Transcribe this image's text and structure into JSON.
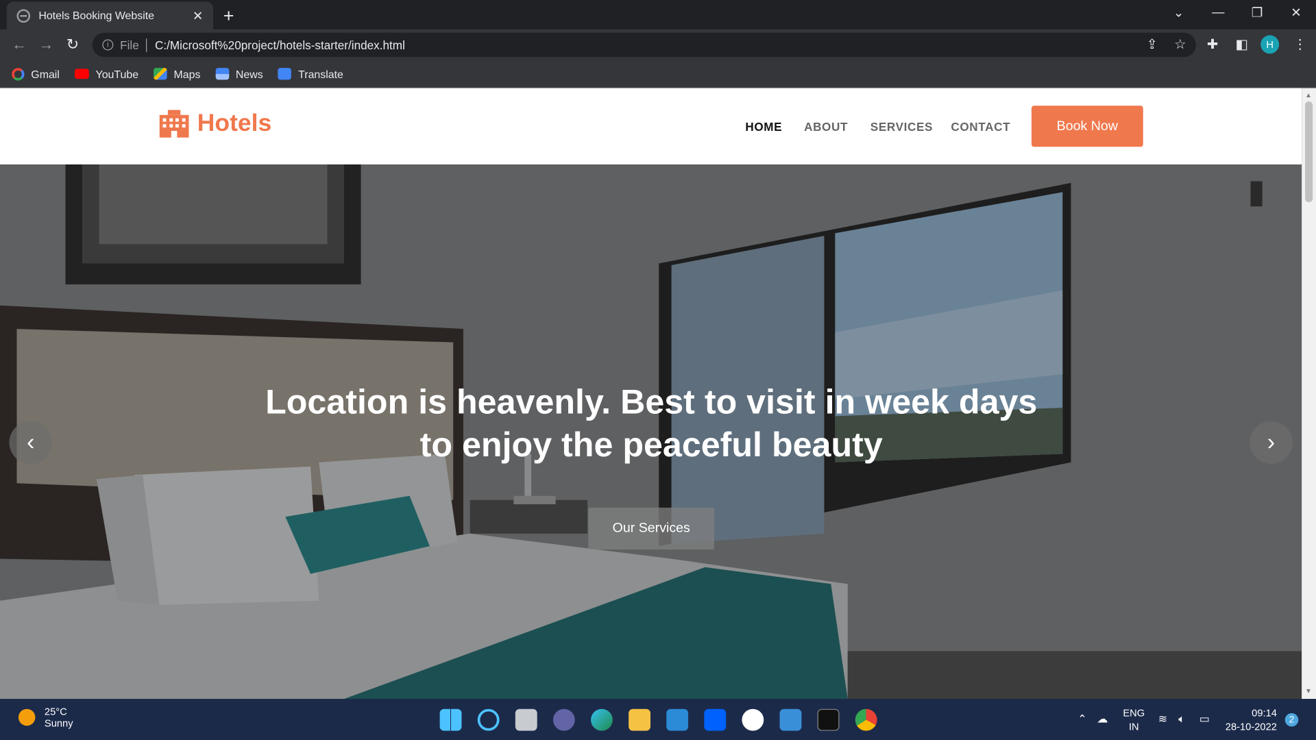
{
  "browser": {
    "tab_title": "Hotels Booking Website",
    "address_prefix": "File",
    "url": "C:/Microsoft%20project/hotels-starter/index.html",
    "profile_initial": "H",
    "bookmarks": [
      {
        "label": "Gmail",
        "color": "#ea4335"
      },
      {
        "label": "YouTube",
        "color": "#ff0000"
      },
      {
        "label": "Maps",
        "color": "#34a853"
      },
      {
        "label": "News",
        "color": "#4285f4"
      },
      {
        "label": "Translate",
        "color": "#4285f4"
      }
    ]
  },
  "site": {
    "brand": "Hotels",
    "brand_color": "#f0784d",
    "nav": [
      {
        "label": "HOME",
        "active": true
      },
      {
        "label": "ABOUT",
        "active": false
      },
      {
        "label": "SERVICES",
        "active": false
      },
      {
        "label": "CONTACT",
        "active": false
      }
    ],
    "cta": "Book Now",
    "hero": {
      "title_line1": "Location is heavenly. Best to visit in week days",
      "title_line2": "to enjoy the peaceful beauty",
      "button": "Our Services"
    }
  },
  "taskbar": {
    "temperature": "25°C",
    "condition": "Sunny",
    "lang_line1": "ENG",
    "lang_line2": "IN",
    "time": "09:14",
    "date": "28-10-2022",
    "notifications": "2"
  }
}
